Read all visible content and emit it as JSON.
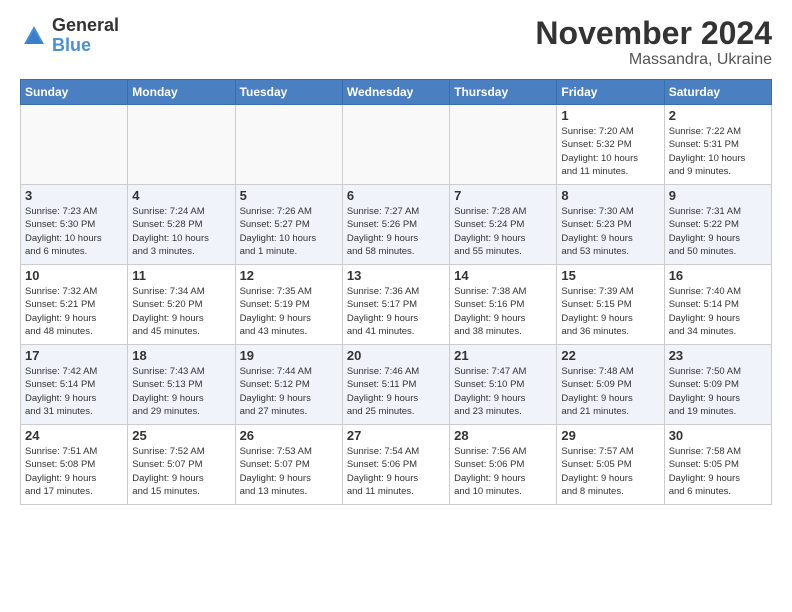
{
  "header": {
    "logo_general": "General",
    "logo_blue": "Blue",
    "month_title": "November 2024",
    "location": "Massandra, Ukraine"
  },
  "weekdays": [
    "Sunday",
    "Monday",
    "Tuesday",
    "Wednesday",
    "Thursday",
    "Friday",
    "Saturday"
  ],
  "weeks": [
    [
      {
        "day": "",
        "info": ""
      },
      {
        "day": "",
        "info": ""
      },
      {
        "day": "",
        "info": ""
      },
      {
        "day": "",
        "info": ""
      },
      {
        "day": "",
        "info": ""
      },
      {
        "day": "1",
        "info": "Sunrise: 7:20 AM\nSunset: 5:32 PM\nDaylight: 10 hours\nand 11 minutes."
      },
      {
        "day": "2",
        "info": "Sunrise: 7:22 AM\nSunset: 5:31 PM\nDaylight: 10 hours\nand 9 minutes."
      }
    ],
    [
      {
        "day": "3",
        "info": "Sunrise: 7:23 AM\nSunset: 5:30 PM\nDaylight: 10 hours\nand 6 minutes."
      },
      {
        "day": "4",
        "info": "Sunrise: 7:24 AM\nSunset: 5:28 PM\nDaylight: 10 hours\nand 3 minutes."
      },
      {
        "day": "5",
        "info": "Sunrise: 7:26 AM\nSunset: 5:27 PM\nDaylight: 10 hours\nand 1 minute."
      },
      {
        "day": "6",
        "info": "Sunrise: 7:27 AM\nSunset: 5:26 PM\nDaylight: 9 hours\nand 58 minutes."
      },
      {
        "day": "7",
        "info": "Sunrise: 7:28 AM\nSunset: 5:24 PM\nDaylight: 9 hours\nand 55 minutes."
      },
      {
        "day": "8",
        "info": "Sunrise: 7:30 AM\nSunset: 5:23 PM\nDaylight: 9 hours\nand 53 minutes."
      },
      {
        "day": "9",
        "info": "Sunrise: 7:31 AM\nSunset: 5:22 PM\nDaylight: 9 hours\nand 50 minutes."
      }
    ],
    [
      {
        "day": "10",
        "info": "Sunrise: 7:32 AM\nSunset: 5:21 PM\nDaylight: 9 hours\nand 48 minutes."
      },
      {
        "day": "11",
        "info": "Sunrise: 7:34 AM\nSunset: 5:20 PM\nDaylight: 9 hours\nand 45 minutes."
      },
      {
        "day": "12",
        "info": "Sunrise: 7:35 AM\nSunset: 5:19 PM\nDaylight: 9 hours\nand 43 minutes."
      },
      {
        "day": "13",
        "info": "Sunrise: 7:36 AM\nSunset: 5:17 PM\nDaylight: 9 hours\nand 41 minutes."
      },
      {
        "day": "14",
        "info": "Sunrise: 7:38 AM\nSunset: 5:16 PM\nDaylight: 9 hours\nand 38 minutes."
      },
      {
        "day": "15",
        "info": "Sunrise: 7:39 AM\nSunset: 5:15 PM\nDaylight: 9 hours\nand 36 minutes."
      },
      {
        "day": "16",
        "info": "Sunrise: 7:40 AM\nSunset: 5:14 PM\nDaylight: 9 hours\nand 34 minutes."
      }
    ],
    [
      {
        "day": "17",
        "info": "Sunrise: 7:42 AM\nSunset: 5:14 PM\nDaylight: 9 hours\nand 31 minutes."
      },
      {
        "day": "18",
        "info": "Sunrise: 7:43 AM\nSunset: 5:13 PM\nDaylight: 9 hours\nand 29 minutes."
      },
      {
        "day": "19",
        "info": "Sunrise: 7:44 AM\nSunset: 5:12 PM\nDaylight: 9 hours\nand 27 minutes."
      },
      {
        "day": "20",
        "info": "Sunrise: 7:46 AM\nSunset: 5:11 PM\nDaylight: 9 hours\nand 25 minutes."
      },
      {
        "day": "21",
        "info": "Sunrise: 7:47 AM\nSunset: 5:10 PM\nDaylight: 9 hours\nand 23 minutes."
      },
      {
        "day": "22",
        "info": "Sunrise: 7:48 AM\nSunset: 5:09 PM\nDaylight: 9 hours\nand 21 minutes."
      },
      {
        "day": "23",
        "info": "Sunrise: 7:50 AM\nSunset: 5:09 PM\nDaylight: 9 hours\nand 19 minutes."
      }
    ],
    [
      {
        "day": "24",
        "info": "Sunrise: 7:51 AM\nSunset: 5:08 PM\nDaylight: 9 hours\nand 17 minutes."
      },
      {
        "day": "25",
        "info": "Sunrise: 7:52 AM\nSunset: 5:07 PM\nDaylight: 9 hours\nand 15 minutes."
      },
      {
        "day": "26",
        "info": "Sunrise: 7:53 AM\nSunset: 5:07 PM\nDaylight: 9 hours\nand 13 minutes."
      },
      {
        "day": "27",
        "info": "Sunrise: 7:54 AM\nSunset: 5:06 PM\nDaylight: 9 hours\nand 11 minutes."
      },
      {
        "day": "28",
        "info": "Sunrise: 7:56 AM\nSunset: 5:06 PM\nDaylight: 9 hours\nand 10 minutes."
      },
      {
        "day": "29",
        "info": "Sunrise: 7:57 AM\nSunset: 5:05 PM\nDaylight: 9 hours\nand 8 minutes."
      },
      {
        "day": "30",
        "info": "Sunrise: 7:58 AM\nSunset: 5:05 PM\nDaylight: 9 hours\nand 6 minutes."
      }
    ]
  ]
}
